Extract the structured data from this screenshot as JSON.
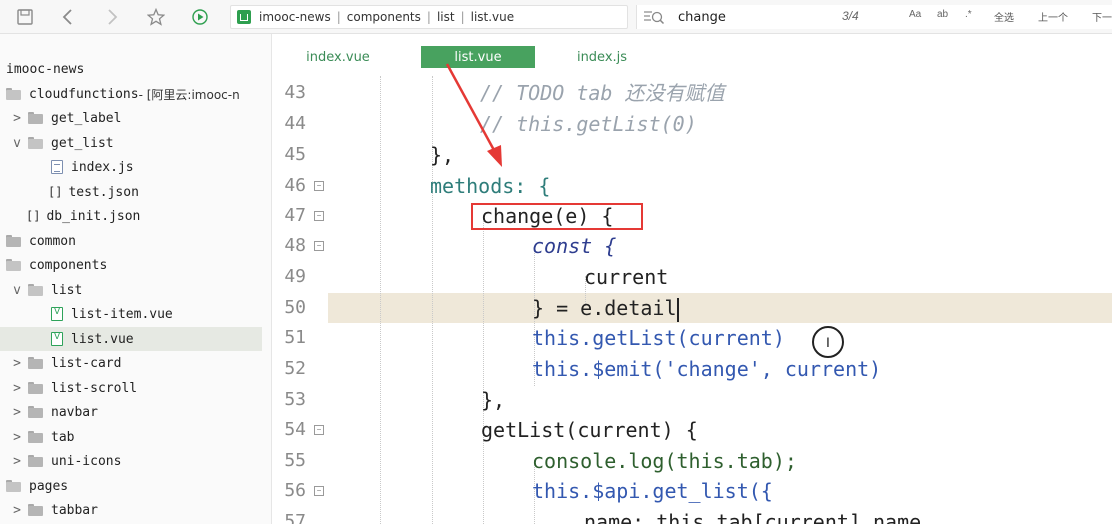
{
  "toolbar": {
    "breadcrumbs": [
      "imooc-news",
      "components",
      "list",
      "list.vue"
    ],
    "search": {
      "query": "change",
      "match_count": "3/4",
      "opt_case": "Aa",
      "opt_word": "ab",
      "opt_regex": ".*",
      "select_all": "全选",
      "prev": "上一个",
      "next": "下一"
    }
  },
  "sidebar": {
    "items": [
      {
        "label": "imooc-news",
        "icon": "none",
        "caret": ""
      },
      {
        "label": "cloudfunctions",
        "suffix": " - [阿里云:imooc-n",
        "icon": "folder-open-icon",
        "caret": ""
      },
      {
        "label": "get_label",
        "icon": "folder-icon",
        "caret": ">"
      },
      {
        "label": "get_list",
        "icon": "folder-open-icon",
        "caret": "v"
      },
      {
        "label": "index.js",
        "icon": "js-file-icon",
        "caret": ""
      },
      {
        "label": "test.json",
        "icon": "json-file-icon",
        "caret": ""
      },
      {
        "label": "db_init.json",
        "icon": "json-file-icon",
        "caret": ""
      },
      {
        "label": "common",
        "icon": "folder-icon",
        "caret": ""
      },
      {
        "label": "components",
        "icon": "folder-open-icon",
        "caret": ""
      },
      {
        "label": "list",
        "icon": "folder-open-icon",
        "caret": "v"
      },
      {
        "label": "list-item.vue",
        "icon": "vue-file-icon",
        "caret": ""
      },
      {
        "label": "list.vue",
        "icon": "vue-file-icon",
        "caret": "",
        "selected": true
      },
      {
        "label": "list-card",
        "icon": "folder-icon",
        "caret": ">"
      },
      {
        "label": "list-scroll",
        "icon": "folder-icon",
        "caret": ">"
      },
      {
        "label": "navbar",
        "icon": "folder-icon",
        "caret": ">"
      },
      {
        "label": "tab",
        "icon": "folder-icon",
        "caret": ">"
      },
      {
        "label": "uni-icons",
        "icon": "folder-icon",
        "caret": ">"
      },
      {
        "label": "pages",
        "icon": "folder-open-icon",
        "caret": ""
      },
      {
        "label": "tabbar",
        "icon": "folder-icon",
        "caret": ">"
      }
    ]
  },
  "tabs": [
    {
      "label": "index.vue",
      "active": false
    },
    {
      "label": "list.vue",
      "active": true
    },
    {
      "label": "index.js",
      "active": false
    }
  ],
  "editor": {
    "lines": [
      {
        "num": "43",
        "fold": false,
        "text": "// TODO tab 还没有赋值"
      },
      {
        "num": "44",
        "fold": false,
        "text": "// this.getList(0)"
      },
      {
        "num": "45",
        "fold": false,
        "text": "},"
      },
      {
        "num": "46",
        "fold": true,
        "text": "methods: {"
      },
      {
        "num": "47",
        "fold": true,
        "text": "change(e) {"
      },
      {
        "num": "48",
        "fold": true,
        "text": "const {"
      },
      {
        "num": "49",
        "fold": false,
        "text": "current"
      },
      {
        "num": "50",
        "fold": false,
        "text": "} = e.detail"
      },
      {
        "num": "51",
        "fold": false,
        "text": "this.getList(current)"
      },
      {
        "num": "52",
        "fold": false,
        "text": "this.$emit('change', current)"
      },
      {
        "num": "53",
        "fold": false,
        "text": "},"
      },
      {
        "num": "54",
        "fold": true,
        "text": "getList(current) {"
      },
      {
        "num": "55",
        "fold": false,
        "text": "console.log(this.tab);"
      },
      {
        "num": "56",
        "fold": true,
        "text": "this.$api.get_list({"
      },
      {
        "num": "57",
        "fold": false,
        "text": "name: this.tab[current].name"
      }
    ]
  },
  "colors": {
    "accent": "#48a25f",
    "annotation": "#e53935",
    "highlight_line": "#efe8d9"
  }
}
